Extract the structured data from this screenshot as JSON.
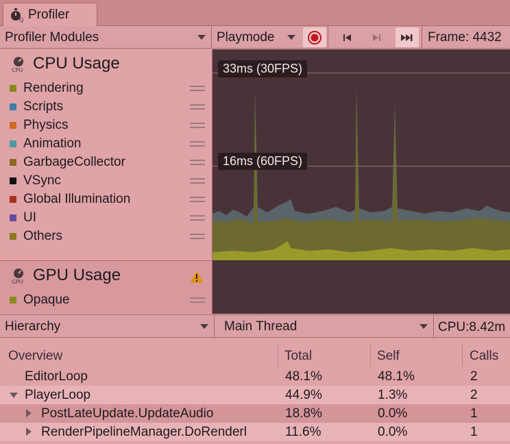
{
  "window": {
    "tab_title": "Profiler"
  },
  "toolbar": {
    "modules_dropdown": "Profiler Modules",
    "playmode_dropdown": "Playmode",
    "frame_label": "Frame: 4432",
    "buttons": [
      "record-icon",
      "step-back-icon",
      "step-forward-icon",
      "last-frame-icon"
    ]
  },
  "cpu_module": {
    "title": "CPU Usage",
    "icon_text": "CPU",
    "legend": [
      {
        "label": "Rendering",
        "color": "#8a8a1e"
      },
      {
        "label": "Scripts",
        "color": "#3f7fa8"
      },
      {
        "label": "Physics",
        "color": "#d06a1e"
      },
      {
        "label": "Animation",
        "color": "#4e9aa0"
      },
      {
        "label": "GarbageCollector",
        "color": "#8a6a1e"
      },
      {
        "label": "VSync",
        "color": "#111111"
      },
      {
        "label": "Global Illumination",
        "color": "#a8321e"
      },
      {
        "label": "UI",
        "color": "#6a4a9a"
      },
      {
        "label": "Others",
        "color": "#8a7a1e"
      }
    ],
    "graph_labels": {
      "fps30": "33ms (30FPS)",
      "fps60": "16ms (60FPS)"
    }
  },
  "gpu_module": {
    "title": "GPU Usage",
    "icon_text": "GPU",
    "warning_icon": "warning-icon",
    "legend": [
      {
        "label": "Opaque",
        "color": "#8a8a1e"
      }
    ]
  },
  "hierarchy_bar": {
    "view_dropdown": "Hierarchy",
    "thread_dropdown": "Main Thread",
    "cpu_readout": "CPU:8.42m"
  },
  "table": {
    "headers": [
      "Overview",
      "Total",
      "Self",
      "Calls"
    ],
    "rows": [
      {
        "name": "EditorLoop",
        "total": "48.1%",
        "self": "48.1%",
        "calls": "2",
        "indent": 0,
        "expander": "none"
      },
      {
        "name": "PlayerLoop",
        "total": "44.9%",
        "self": "1.3%",
        "calls": "2",
        "indent": 0,
        "expander": "expanded"
      },
      {
        "name": "PostLateUpdate.UpdateAudio",
        "total": "18.8%",
        "self": "0.0%",
        "calls": "1",
        "indent": 1,
        "expander": "collapsed"
      },
      {
        "name": "RenderPipelineManager.DoRenderl",
        "total": "11.6%",
        "self": "0.0%",
        "calls": "1",
        "indent": 1,
        "expander": "collapsed"
      }
    ]
  }
}
